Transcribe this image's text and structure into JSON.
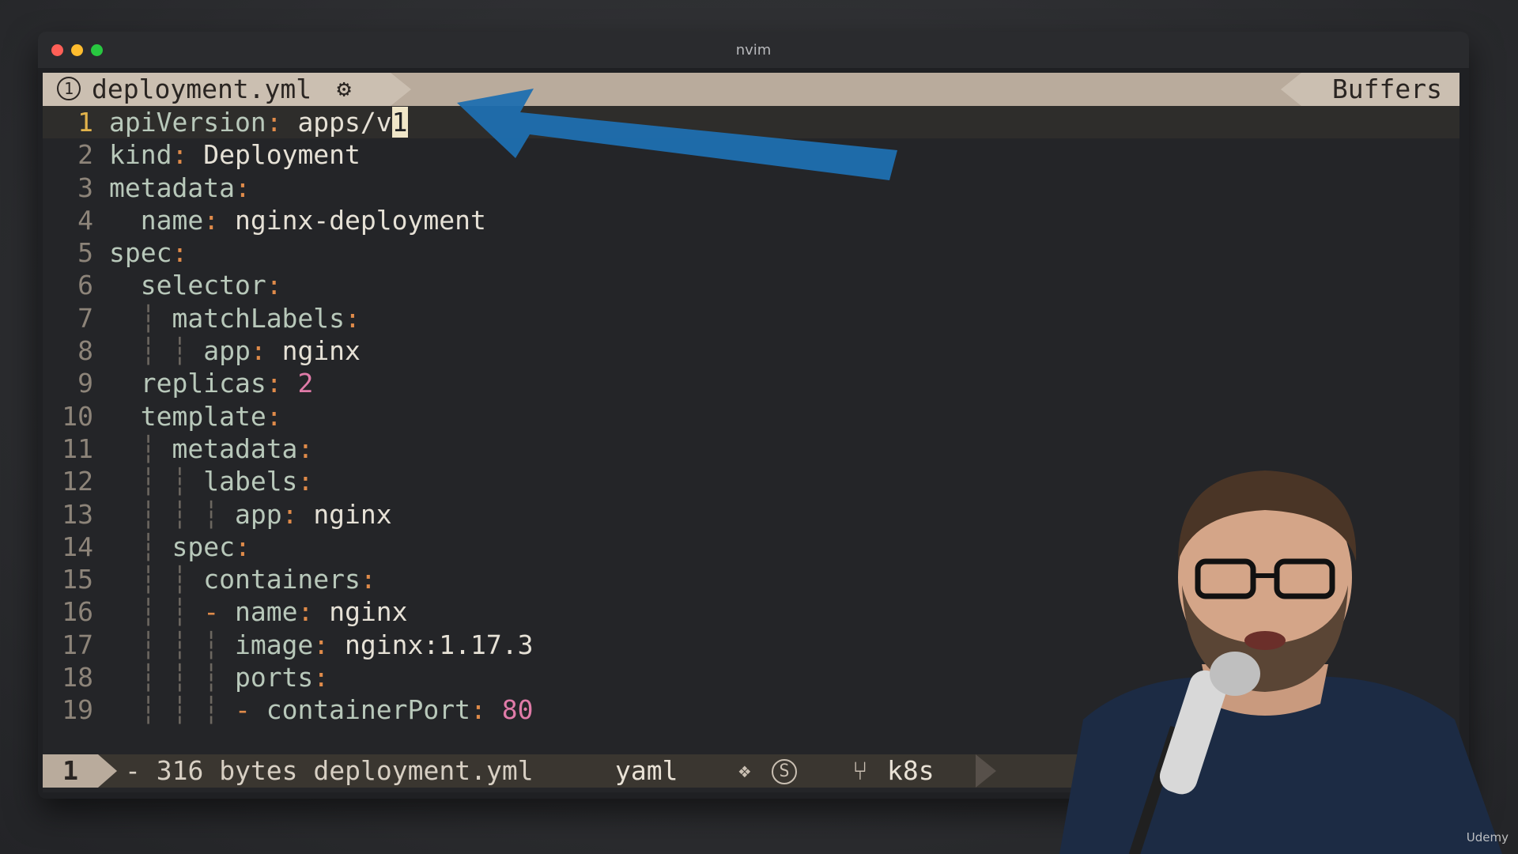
{
  "window": {
    "title": "nvim"
  },
  "tabline": {
    "tab_number": "1",
    "tab_name": "deployment.yml",
    "tab_icon": "gear-icon",
    "right_label": "Buffers"
  },
  "editor": {
    "current_line": 1,
    "cursor_char": "1",
    "lines": [
      {
        "n": "1",
        "guides": "",
        "key": "apiVersion",
        "value": "apps/v",
        "value_type": "string"
      },
      {
        "n": "2",
        "guides": "",
        "key": "kind",
        "value": "Deployment",
        "value_type": "string"
      },
      {
        "n": "3",
        "guides": "",
        "key": "metadata",
        "value": "",
        "value_type": "none"
      },
      {
        "n": "4",
        "guides": "  ",
        "key": "name",
        "value": "nginx-deployment",
        "value_type": "string"
      },
      {
        "n": "5",
        "guides": "",
        "key": "spec",
        "value": "",
        "value_type": "none"
      },
      {
        "n": "6",
        "guides": "  ",
        "key": "selector",
        "value": "",
        "value_type": "none"
      },
      {
        "n": "7",
        "guides": "  ┆ ",
        "key": "matchLabels",
        "value": "",
        "value_type": "none"
      },
      {
        "n": "8",
        "guides": "  ┆ ┆ ",
        "key": "app",
        "value": "nginx",
        "value_type": "string"
      },
      {
        "n": "9",
        "guides": "  ",
        "key": "replicas",
        "value": "2",
        "value_type": "number"
      },
      {
        "n": "10",
        "guides": "  ",
        "key": "template",
        "value": "",
        "value_type": "none"
      },
      {
        "n": "11",
        "guides": "  ┆ ",
        "key": "metadata",
        "value": "",
        "value_type": "none"
      },
      {
        "n": "12",
        "guides": "  ┆ ┆ ",
        "key": "labels",
        "value": "",
        "value_type": "none"
      },
      {
        "n": "13",
        "guides": "  ┆ ┆ ┆ ",
        "key": "app",
        "value": "nginx",
        "value_type": "string"
      },
      {
        "n": "14",
        "guides": "  ┆ ",
        "key": "spec",
        "value": "",
        "value_type": "none"
      },
      {
        "n": "15",
        "guides": "  ┆ ┆ ",
        "key": "containers",
        "value": "",
        "value_type": "none"
      },
      {
        "n": "16",
        "guides": "  ┆ ┆ - ",
        "key": "name",
        "value": "nginx",
        "value_type": "string"
      },
      {
        "n": "17",
        "guides": "  ┆ ┆ ┆ ",
        "key": "image",
        "value": "nginx:1.17.3",
        "value_type": "string"
      },
      {
        "n": "18",
        "guides": "  ┆ ┆ ┆ ",
        "key": "ports",
        "value": "",
        "value_type": "none"
      },
      {
        "n": "19",
        "guides": "  ┆ ┆ ┆ - ",
        "key": "containerPort",
        "value": "80",
        "value_type": "number"
      }
    ]
  },
  "statusline": {
    "mode": "1",
    "info": "- 316 bytes deployment.yml",
    "filetype": "yaml",
    "diamond_icon": "diamond-icon",
    "s_badge": "S",
    "branch_icon": "git-branch-icon",
    "branch": "k8s"
  },
  "overlay": {
    "watermark": "Udemy"
  },
  "colors": {
    "key": "#b8c8ba",
    "punctuation": "#e08b4a",
    "number": "#e07ba8",
    "annotation_arrow": "#1f6fb0"
  }
}
